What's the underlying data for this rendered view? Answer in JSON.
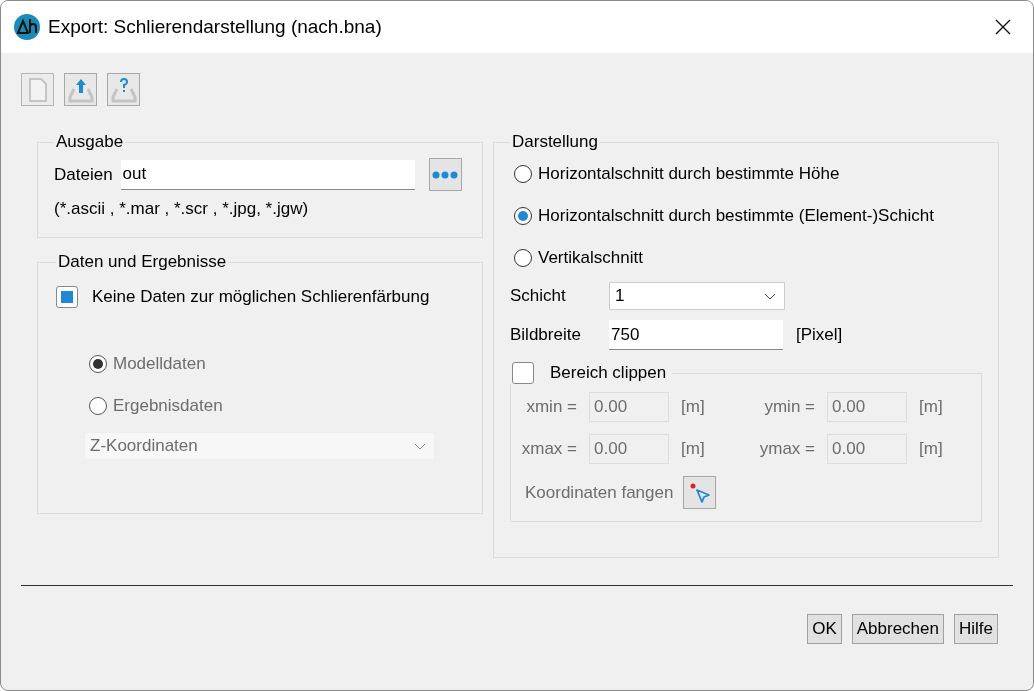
{
  "window": {
    "title": "Export: Schlierendarstellung (nach.bna)"
  },
  "toolbar": [
    {
      "kind": "new",
      "disabled": true
    },
    {
      "kind": "export",
      "disabled": false
    },
    {
      "kind": "help",
      "disabled": false
    }
  ],
  "ausgabe": {
    "legend": "Ausgabe",
    "files_label": "Dateien",
    "files_value": "out",
    "hint": "(*.ascii , *.mar , *.scr , *.jpg, *.jgw)"
  },
  "daten": {
    "legend": "Daten und Ergebnisse",
    "checkbox": {
      "label": "Keine Daten zur möglichen Schlierenfärbung",
      "checked": true
    },
    "radios": [
      {
        "label": "Modelldaten",
        "selected": true,
        "disabled": true
      },
      {
        "label": "Ergebnisdaten",
        "selected": false,
        "disabled": true
      }
    ],
    "dropdown": {
      "value": "Z-Koordinaten",
      "disabled": true
    }
  },
  "darstellung": {
    "legend": "Darstellung",
    "radios": [
      {
        "label": "Horizontalschnitt durch bestimmte Höhe",
        "selected": false,
        "disabled": false
      },
      {
        "label": "Horizontalschnitt durch bestimmte (Element-)Schicht",
        "selected": true,
        "disabled": false
      },
      {
        "label": "Vertikalschnitt",
        "selected": false,
        "disabled": false
      }
    ],
    "schicht_label": "Schicht",
    "schicht_value": "1",
    "width_label": "Bildbreite",
    "width_value": "750",
    "width_unit": "[Pixel]",
    "clip": {
      "label": "Bereich clippen",
      "checked": false,
      "disabled": true,
      "fields": [
        {
          "label": "xmin =",
          "value": "0.00",
          "unit": "[m]"
        },
        {
          "label": "ymin =",
          "value": "0.00",
          "unit": "[m]"
        },
        {
          "label": "xmax =",
          "value": "0.00",
          "unit": "[m]"
        },
        {
          "label": "ymax =",
          "value": "0.00",
          "unit": "[m]"
        }
      ],
      "capture_label": "Koordinaten fangen"
    }
  },
  "buttons": [
    "OK",
    "Abbrechen",
    "Hilfe"
  ]
}
